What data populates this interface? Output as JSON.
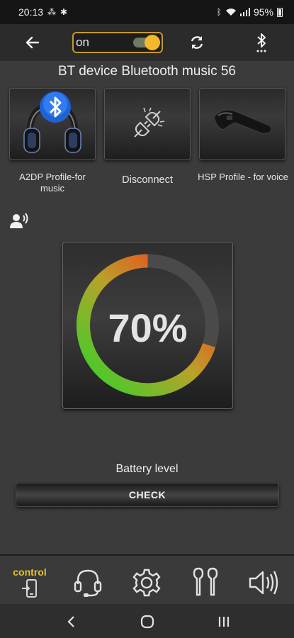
{
  "status_bar": {
    "time": "20:13",
    "battery": "95%",
    "icons": [
      "nfc-icon",
      "star-icon",
      "bluetooth-icon",
      "mute-icon",
      "wifi-icon",
      "signal-icon",
      "battery-icon"
    ]
  },
  "toolbar": {
    "switch_label": "on",
    "switch_on": true,
    "back_icon": "arrow-left-icon",
    "refresh_icon": "sync-icon",
    "bluetooth_icon": "bluetooth-search-icon"
  },
  "device": {
    "title": "BT device Bluetooth music 56"
  },
  "profiles": [
    {
      "label": "A2DP Profile-for music",
      "icon": "headphones-bluetooth-icon"
    },
    {
      "label": "Disconnect",
      "icon": "unplug-icon"
    },
    {
      "label": "HSP Profile - for voice",
      "icon": "bluetooth-headset-icon"
    }
  ],
  "battery": {
    "level": 0.7,
    "display": "70%",
    "label": "Battery level",
    "check_label": "CHECK"
  },
  "tabs": [
    {
      "label": "control",
      "icon": "control-device-icon",
      "active": true
    },
    {
      "label": "",
      "icon": "headset-icon"
    },
    {
      "label": "",
      "icon": "gear-icon"
    },
    {
      "label": "",
      "icon": "earbuds-icon"
    },
    {
      "label": "",
      "icon": "speaker-icon"
    }
  ],
  "colors": {
    "accent": "#f5b72d",
    "gauge_start": "#2fd32b",
    "gauge_mid": "#b9a22a",
    "gauge_end": "#ff2a16"
  }
}
